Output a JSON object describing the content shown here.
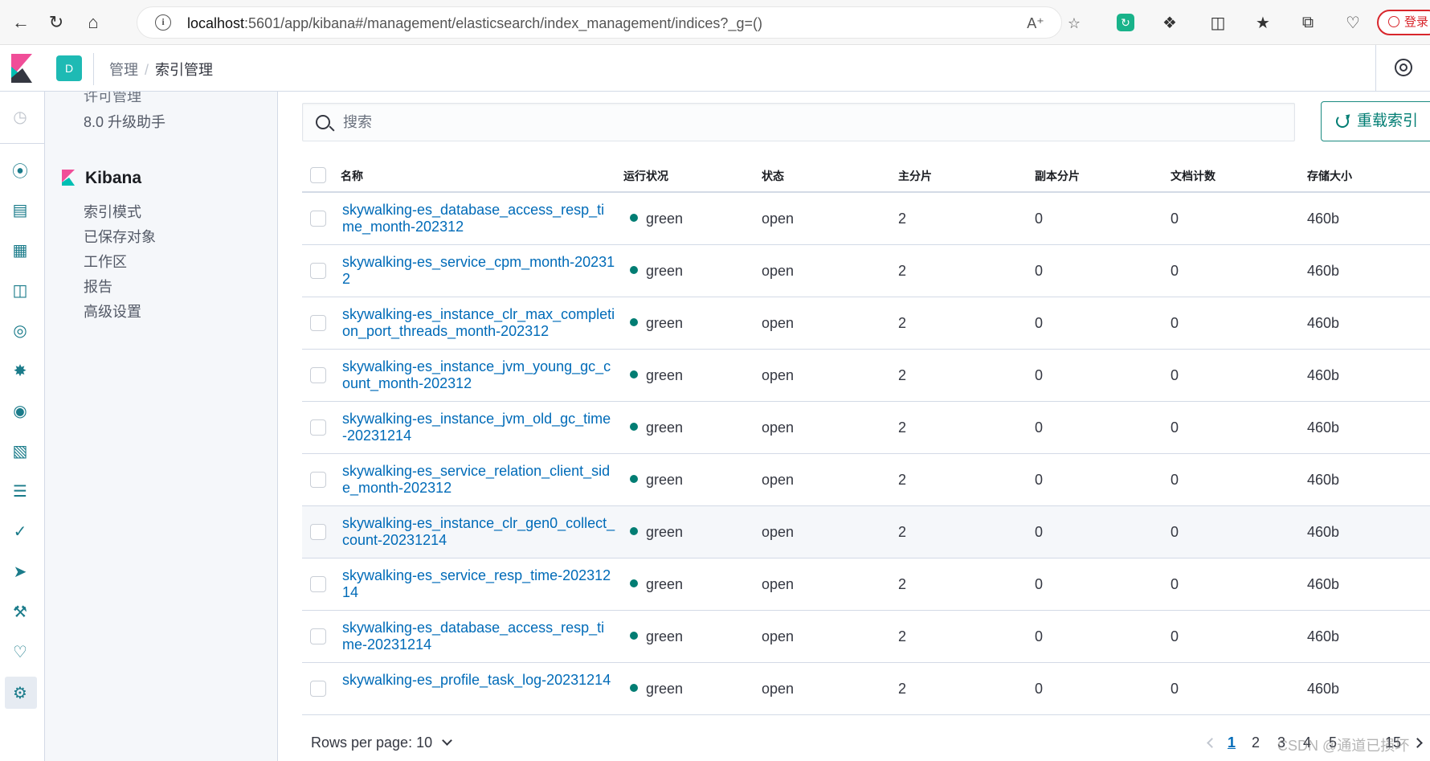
{
  "browser": {
    "url_host": "localhost",
    "url_path": ":5601/app/kibana#/management/elasticsearch/index_management/indices?_g=()",
    "login_label": "登录"
  },
  "header": {
    "space_initial": "D",
    "breadcrumb_parent": "管理",
    "breadcrumb_current": "索引管理"
  },
  "sidebar": {
    "items_top": [
      "许可管理",
      "8.0 升级助手"
    ],
    "group_title": "Kibana",
    "group_items": [
      "索引模式",
      "已保存对象",
      "工作区",
      "报告",
      "高级设置"
    ]
  },
  "toolbar": {
    "search_placeholder": "搜索",
    "reload_label": "重载索引"
  },
  "table": {
    "columns": [
      "名称",
      "运行状况",
      "状态",
      "主分片",
      "副本分片",
      "文档计数",
      "存储大小"
    ],
    "rows": [
      {
        "name": "skywalking-es_database_access_resp_time_month-202312",
        "health": "green",
        "status": "open",
        "primary": "2",
        "replicas": "0",
        "docs": "0",
        "size": "460b"
      },
      {
        "name": "skywalking-es_service_cpm_month-202312",
        "health": "green",
        "status": "open",
        "primary": "2",
        "replicas": "0",
        "docs": "0",
        "size": "460b"
      },
      {
        "name": "skywalking-es_instance_clr_max_completion_port_threads_month-202312",
        "health": "green",
        "status": "open",
        "primary": "2",
        "replicas": "0",
        "docs": "0",
        "size": "460b"
      },
      {
        "name": "skywalking-es_instance_jvm_young_gc_count_month-202312",
        "health": "green",
        "status": "open",
        "primary": "2",
        "replicas": "0",
        "docs": "0",
        "size": "460b"
      },
      {
        "name": "skywalking-es_instance_jvm_old_gc_time-20231214",
        "health": "green",
        "status": "open",
        "primary": "2",
        "replicas": "0",
        "docs": "0",
        "size": "460b"
      },
      {
        "name": "skywalking-es_service_relation_client_side_month-202312",
        "health": "green",
        "status": "open",
        "primary": "2",
        "replicas": "0",
        "docs": "0",
        "size": "460b"
      },
      {
        "name": "skywalking-es_instance_clr_gen0_collect_count-20231214",
        "health": "green",
        "status": "open",
        "primary": "2",
        "replicas": "0",
        "docs": "0",
        "size": "460b"
      },
      {
        "name": "skywalking-es_service_resp_time-20231214",
        "health": "green",
        "status": "open",
        "primary": "2",
        "replicas": "0",
        "docs": "0",
        "size": "460b"
      },
      {
        "name": "skywalking-es_database_access_resp_time-20231214",
        "health": "green",
        "status": "open",
        "primary": "2",
        "replicas": "0",
        "docs": "0",
        "size": "460b"
      },
      {
        "name": "skywalking-es_profile_task_log-20231214",
        "health": "green",
        "status": "open",
        "primary": "2",
        "replicas": "0",
        "docs": "0",
        "size": "460b"
      }
    ]
  },
  "footer": {
    "rows_per_page": "Rows per page: 10",
    "pages": [
      "1",
      "2",
      "3",
      "4",
      "5",
      "15"
    ],
    "watermark": "CSDN @通道已损坏"
  },
  "colors": {
    "accent": "#017d73",
    "link": "#006bb8",
    "health_green": "#017d73",
    "login_red": "#d8262c"
  }
}
